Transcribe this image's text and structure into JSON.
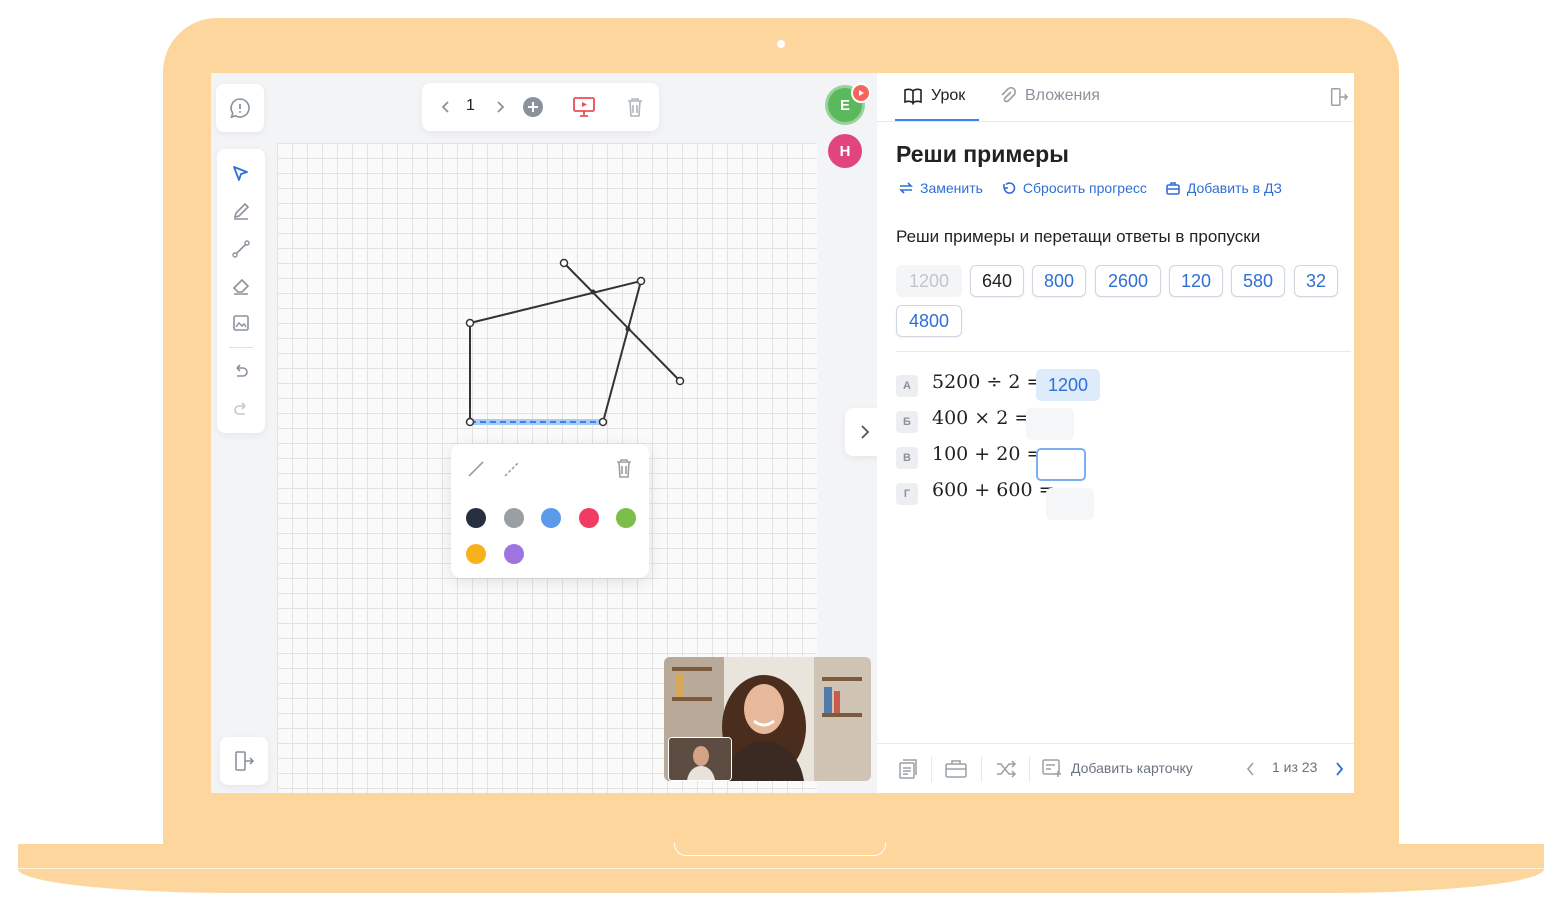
{
  "board": {
    "page_number": "1"
  },
  "popup": {
    "colors": [
      "#263040",
      "#9a9fa4",
      "#5b9ae8",
      "#f03c63",
      "#7dbd4a",
      "#f7b21b",
      "#9e75e0"
    ]
  },
  "avatars": [
    {
      "initial": "Е",
      "color": "#5cb85c"
    },
    {
      "initial": "Н",
      "color": "#e0467c"
    }
  ],
  "panel": {
    "tabs": [
      {
        "label": "Урок",
        "icon": "book-icon",
        "active": true
      },
      {
        "label": "Вложения",
        "icon": "paperclip-icon",
        "active": false
      }
    ],
    "title": "Реши примеры",
    "actions": [
      {
        "label": "Заменить",
        "icon": "swap-icon"
      },
      {
        "label": "Сбросить прогресс",
        "icon": "reset-icon"
      },
      {
        "label": "Добавить в ДЗ",
        "icon": "briefcase-icon"
      }
    ],
    "task": "Реши примеры и перетащи ответы в пропуски",
    "chips": [
      "1200",
      "640",
      "800",
      "2600",
      "120",
      "580",
      "32",
      "4800"
    ],
    "rows": [
      {
        "letter": "А",
        "expr": "5200 ÷ 2 =",
        "answer": "1200"
      },
      {
        "letter": "Б",
        "expr": "400 × 2 =",
        "answer": ""
      },
      {
        "letter": "В",
        "expr": "100 + 20 =",
        "answer": ""
      },
      {
        "letter": "Г",
        "expr": "600 + 600 =",
        "answer": ""
      }
    ],
    "footer": {
      "add_card": "Добавить карточку",
      "pager": "1 из 23"
    }
  }
}
